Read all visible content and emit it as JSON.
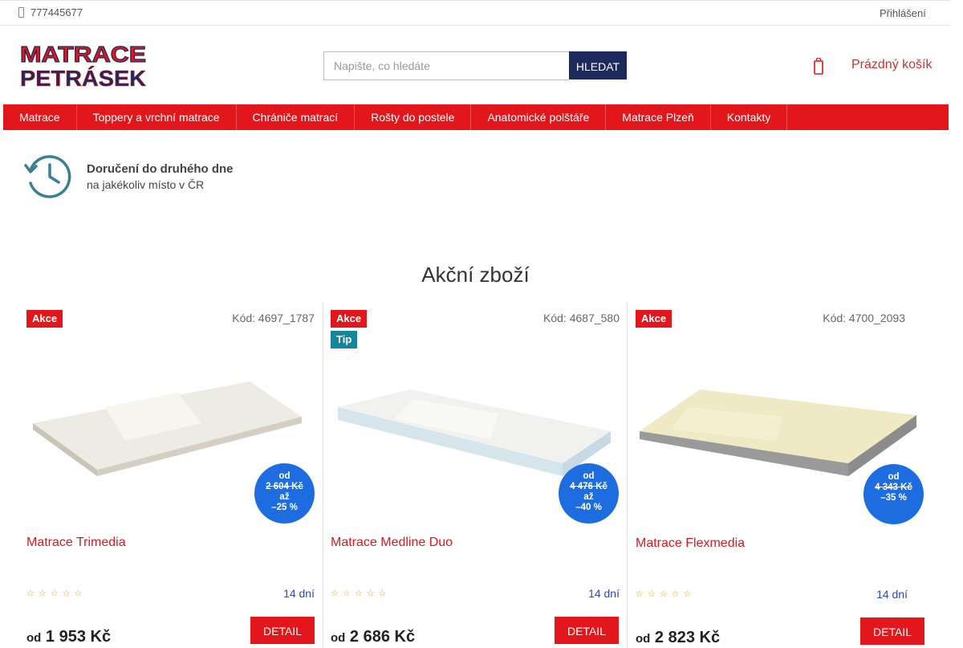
{
  "topbar": {
    "phone": "777445677",
    "login": "Přihlášení"
  },
  "logo": {
    "line1": "MATRACE",
    "line2": "PETRÁSEK"
  },
  "search": {
    "placeholder": "Napište, co hledáte",
    "button": "HLEDAT"
  },
  "cart": {
    "label": "Prázdný košík"
  },
  "nav": [
    "Matrace",
    "Toppery a vrchní matrace",
    "Chrániče matrací",
    "Rošty do postele",
    "Anatomické polštáře",
    "Matrace Plzeň",
    "Kontakty"
  ],
  "delivery": {
    "title": "Doručení do druhého dne",
    "subtitle": "na jakékoliv místo v ČR"
  },
  "section_title": "Akční zboží",
  "products": [
    {
      "flags": [
        "Akce"
      ],
      "code": "Kód: 4697_1787",
      "disc_from": "od",
      "disc_old": "2 604 Kč",
      "disc_to": "až",
      "disc_pct": "–25 %",
      "name": "Matrace Trimedia",
      "stars": "☆☆☆☆☆",
      "availability": "14 dní",
      "price_from": "od",
      "price": "1 953 Kč",
      "detail": "DETAIL"
    },
    {
      "flags": [
        "Akce",
        "Tip"
      ],
      "code": "Kód: 4687_580",
      "disc_from": "od",
      "disc_old": "4 476 Kč",
      "disc_to": "až",
      "disc_pct": "–40 %",
      "name": "Matrace Medline Duo",
      "stars": "☆☆☆☆☆",
      "availability": "14 dní",
      "price_from": "od",
      "price": "2 686 Kč",
      "detail": "DETAIL"
    },
    {
      "flags": [
        "Akce"
      ],
      "code": "Kód: 4700_2093",
      "disc_from": "od",
      "disc_old": "4 343 Kč",
      "disc_to": "",
      "disc_pct": "–35 %",
      "name": "Matrace Flexmedia",
      "stars": "☆☆☆☆☆",
      "availability": "14 dní",
      "price_from": "od",
      "price": "2 823 Kč",
      "detail": "DETAIL"
    }
  ],
  "colors": {
    "brand_red": "#e3161b",
    "navy": "#1f2a5c",
    "discount_blue": "#1e6de0",
    "tip_teal": "#13869b"
  }
}
